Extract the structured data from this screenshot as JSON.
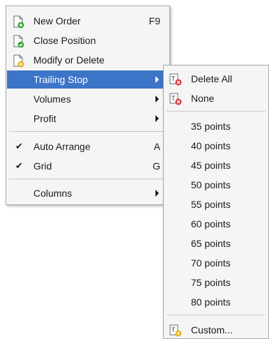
{
  "main_menu": {
    "items": [
      {
        "label": "New Order",
        "shortcut": "F9",
        "icon": "new-order-icon"
      },
      {
        "label": "Close Position",
        "icon": "close-position-icon"
      },
      {
        "label": "Modify or Delete",
        "icon": "modify-delete-icon"
      },
      {
        "label": "Trailing Stop",
        "highlighted": true
      },
      {
        "label": "Volumes"
      },
      {
        "label": "Profit"
      },
      {
        "label": "Auto Arrange",
        "shortcut": "A",
        "checked": true
      },
      {
        "label": "Grid",
        "shortcut": "G",
        "checked": true
      },
      {
        "label": "Columns"
      }
    ]
  },
  "submenu": {
    "items": [
      {
        "label": "Delete All",
        "icon": "delete-all-icon"
      },
      {
        "label": "None",
        "icon": "trailing-none-icon"
      },
      {
        "label": "35 points"
      },
      {
        "label": "40 points"
      },
      {
        "label": "45 points"
      },
      {
        "label": "50 points"
      },
      {
        "label": "55 points"
      },
      {
        "label": "60 points"
      },
      {
        "label": "65 points"
      },
      {
        "label": "70 points"
      },
      {
        "label": "75 points"
      },
      {
        "label": "80 points"
      },
      {
        "label": "Custom...",
        "icon": "custom-icon"
      }
    ]
  },
  "colors": {
    "highlight": "#3c74c8",
    "menu_bg": "#f5f5f5",
    "border": "#a8a8a8"
  }
}
